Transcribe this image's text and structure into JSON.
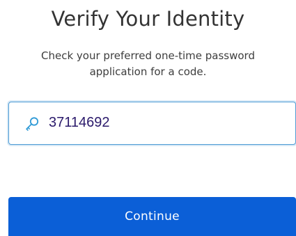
{
  "header": {
    "title": "Verify Your Identity",
    "subtitle": "Check your preferred one-time password application for a code."
  },
  "form": {
    "code_field": {
      "icon": "key-icon",
      "value": "37114692"
    },
    "continue_label": "Continue"
  },
  "colors": {
    "accent": "#0b5fd7",
    "field_border": "#4d9bd4",
    "icon": "#2f9ad6",
    "value_text": "#2b1a6b"
  }
}
